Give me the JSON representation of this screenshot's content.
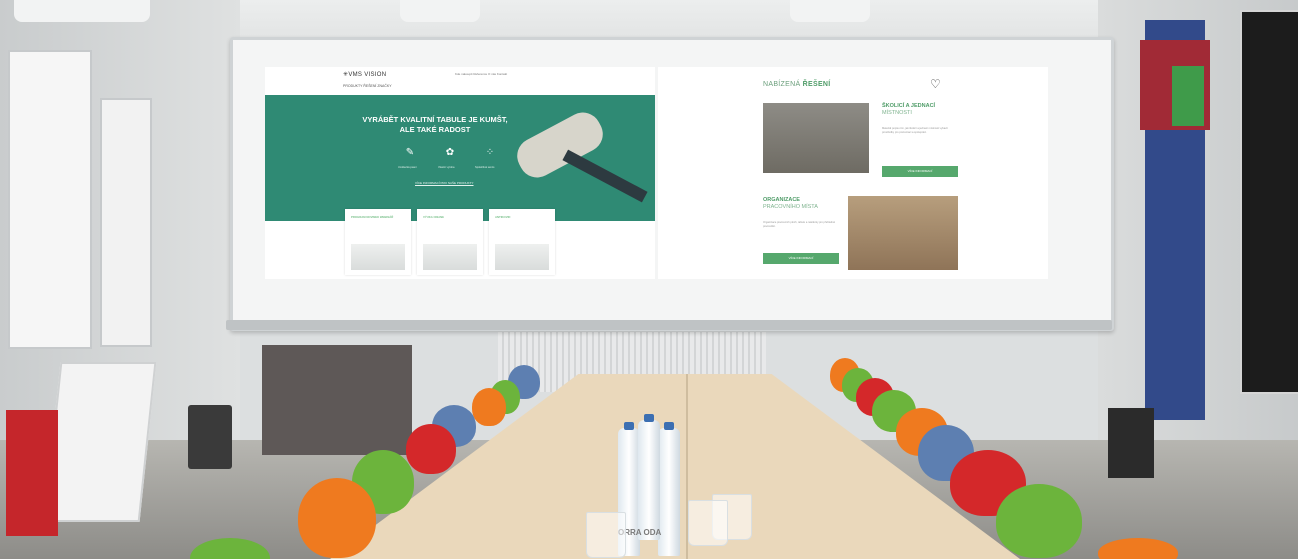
{
  "left_screen": {
    "logo": "✳VMS VISION",
    "top_nav": "Kde nakoupit   Reference   O nás   Kontakt",
    "main_nav": "PRODUKTY   ŘEŠENÍ   ZNAČKY",
    "hero_title": "VYRÁBĚT KVALITNÍ TABULE JE KUMŠT, ALE TAKÉ RADOST",
    "hero_icons": [
      {
        "icon": "pen-icon",
        "caption": "Umělecká psaní"
      },
      {
        "icon": "palette-icon",
        "caption": "Vlastní výroba"
      },
      {
        "icon": "dots-icon",
        "caption": "Spolehlivá servis"
      }
    ],
    "hero_link": "VÍCE INFORMACÍ PRO NAŠE PRODUKTY",
    "cards": [
      {
        "label": "PROGRAM NOVINEK WEBINÁŘ"
      },
      {
        "label": "VÝUKA ONLINE"
      },
      {
        "label": "ANTIKOVID"
      }
    ]
  },
  "right_screen": {
    "heading_light": "NABÍZENÁ",
    "heading_bold": "ŘEŠENÍ",
    "section1_title_bold": "ŠKOLICÍ A JEDNACÍ",
    "section1_title_light": "MÍSTNOSTI",
    "section1_text": "Materiál popisu tím, jak školicí a jednací místnosti vybavit prostředky pro prezentaci a spolupráci.",
    "section1_button": "VÍCE INFORMACÍ",
    "section2_title_bold": "ORGANIZACE",
    "section2_title_light": "PRACOVNÍHO MÍSTA",
    "section2_text": "Organizace pracovních ploch, tabule a nástěnky pro přehledné pracoviště.",
    "section2_button": "VÍCE INFORMACÍ"
  },
  "bottle_label": "ORRA ODA",
  "colors": {
    "hero_green": "#2f8a74",
    "accent_green": "#56a86d",
    "chair_orange": "#ef7a1f",
    "chair_green": "#6cb43c",
    "chair_red": "#d4282a",
    "chair_blue": "#5d7fb1",
    "table": "#ead8bb"
  }
}
